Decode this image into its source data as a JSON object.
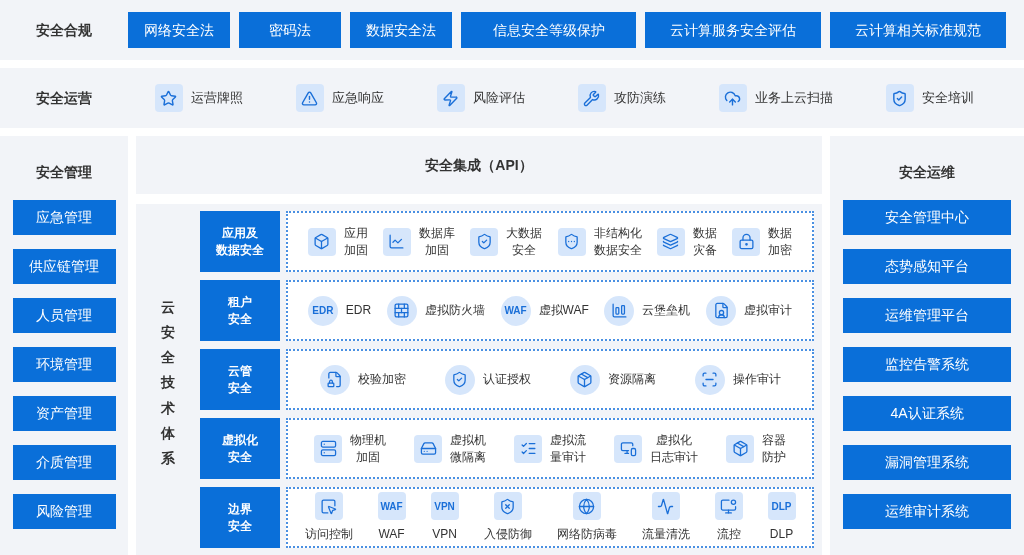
{
  "compliance": {
    "title": "安全合规",
    "items": [
      "网络安全法",
      "密码法",
      "数据安全法",
      "信息安全等级保护",
      "云计算服务安全评估",
      "云计算相关标准规范"
    ]
  },
  "operations": {
    "title": "安全运营",
    "items": [
      "运营牌照",
      "应急响应",
      "风险评估",
      "攻防演练",
      "业务上云扫描",
      "安全培训"
    ]
  },
  "management": {
    "title": "安全管理",
    "items": [
      "应急管理",
      "供应链管理",
      "人员管理",
      "环境管理",
      "资产管理",
      "介质管理",
      "风险管理"
    ]
  },
  "integration": {
    "title": "安全集成（API）"
  },
  "tech": {
    "title": "云安全技术体系",
    "rows": [
      {
        "label": [
          "应用及",
          "数据安全"
        ],
        "kind": "square",
        "items": [
          {
            "label": [
              "应用",
              "加固"
            ]
          },
          {
            "label": [
              "数据库",
              "加固"
            ]
          },
          {
            "label": [
              "大数据",
              "安全"
            ]
          },
          {
            "label": [
              "非结构化",
              "数据安全"
            ]
          },
          {
            "label": [
              "数据",
              "灾备"
            ]
          },
          {
            "label": [
              "数据",
              "加密"
            ]
          }
        ]
      },
      {
        "label": [
          "租户",
          "安全"
        ],
        "kind": "circle",
        "items": [
          {
            "label": [
              "EDR"
            ],
            "badge": "EDR"
          },
          {
            "label": [
              "虚拟防火墙"
            ]
          },
          {
            "label": [
              "虚拟WAF"
            ],
            "badge": "WAF"
          },
          {
            "label": [
              "云堡垒机"
            ]
          },
          {
            "label": [
              "虚拟审计"
            ]
          }
        ]
      },
      {
        "label": [
          "云管",
          "安全"
        ],
        "kind": "circle",
        "items": [
          {
            "label": [
              "校验加密"
            ]
          },
          {
            "label": [
              "认证授权"
            ]
          },
          {
            "label": [
              "资源隔离"
            ]
          },
          {
            "label": [
              "操作审计"
            ]
          }
        ]
      },
      {
        "label": [
          "虚拟化",
          "安全"
        ],
        "kind": "square",
        "items": [
          {
            "label": [
              "物理机",
              "加固"
            ]
          },
          {
            "label": [
              "虚拟机",
              "微隔离"
            ]
          },
          {
            "label": [
              "虚拟流",
              "量审计"
            ]
          },
          {
            "label": [
              "虚拟化",
              "日志审计"
            ]
          },
          {
            "label": [
              "容器",
              "防护"
            ]
          }
        ]
      },
      {
        "label": [
          "边界",
          "安全"
        ],
        "kind": "stacked",
        "items": [
          {
            "label": [
              "访问控制"
            ]
          },
          {
            "label": [
              "WAF"
            ],
            "badge": "WAF"
          },
          {
            "label": [
              "VPN"
            ],
            "badge": "VPN"
          },
          {
            "label": [
              "入侵防御"
            ]
          },
          {
            "label": [
              "网络防病毒"
            ]
          },
          {
            "label": [
              "流量清洗"
            ]
          },
          {
            "label": [
              "流控"
            ]
          },
          {
            "label": [
              "DLP"
            ],
            "badge": "DLP"
          }
        ]
      }
    ]
  },
  "maintenance": {
    "title": "安全运维",
    "items": [
      "安全管理中心",
      "态势感知平台",
      "运维管理平台",
      "监控告警系统",
      "4A认证系统",
      "漏洞管理系统",
      "运维审计系统"
    ]
  }
}
